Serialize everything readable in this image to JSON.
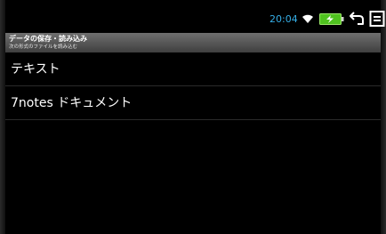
{
  "status_bar": {
    "time": "20:04",
    "icons": [
      "wifi-icon",
      "battery-charging-icon",
      "back-icon",
      "menu-icon"
    ],
    "time_color": "#35aee6",
    "battery_color": "#6be02a"
  },
  "dialog": {
    "title": "データの保存・読み込み",
    "subtitle": "次の形式のファイルを読み込む",
    "items": [
      {
        "label": "テキスト"
      },
      {
        "label": "7notes ドキュメント"
      }
    ]
  }
}
